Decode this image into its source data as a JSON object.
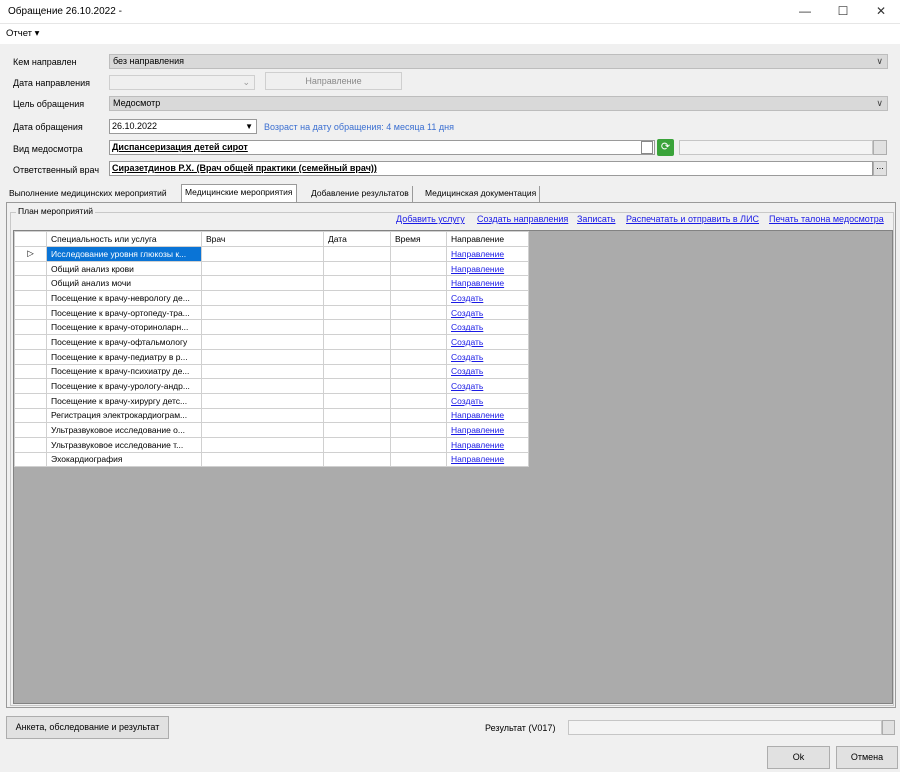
{
  "window": {
    "title": "Обращение 26.10.2022 -",
    "minimize": "—",
    "maximize": "☐",
    "close": "✕"
  },
  "menu": {
    "report": "Отчет ▾"
  },
  "form": {
    "referred_by": {
      "label": "Кем направлен",
      "value": "без направления"
    },
    "referral_date": {
      "label": "Дата направления",
      "value": "",
      "button": "Направление"
    },
    "purpose": {
      "label": "Цель обращения",
      "value": "Медосмотр"
    },
    "visit_date": {
      "label": "Дата обращения",
      "value": "26.10.2022",
      "age_note": "Возраст на дату обращения: 4 месяца 11 дня"
    },
    "exam_type": {
      "label": "Вид медосмотра",
      "value": "Диспансеризация детей сирот"
    },
    "doctor": {
      "label": "Ответственный врач",
      "value": "Сиразетдинов Р.Х. (Врач общей практики (семейный врач))"
    }
  },
  "tabs": [
    {
      "label": "Выполнение медицинских мероприятий"
    },
    {
      "label": "Медицинские мероприятия"
    },
    {
      "label": "Добавление результатов"
    },
    {
      "label": "Медицинская документация"
    }
  ],
  "plan": {
    "group_title": "План мероприятий",
    "actions": [
      "Добавить услугу",
      "Создать направления",
      "Записать",
      "Распечатать и отправить в ЛИС",
      "Печать талона медосмотра"
    ],
    "columns": [
      "Специальность или услуга",
      "Врач",
      "Дата",
      "Время",
      "Направление"
    ],
    "rows": [
      {
        "service": "Исследование уровня глюкозы к...",
        "doctor": "",
        "date": "",
        "time": "",
        "link": "Направление"
      },
      {
        "service": "Общий анализ крови",
        "doctor": "",
        "date": "",
        "time": "",
        "link": "Направление"
      },
      {
        "service": "Общий анализ мочи",
        "doctor": "",
        "date": "",
        "time": "",
        "link": "Направление"
      },
      {
        "service": "Посещение к врачу-неврологу де...",
        "doctor": "",
        "date": "",
        "time": "",
        "link": "Создать"
      },
      {
        "service": "Посещение к врачу-ортопеду-тра...",
        "doctor": "",
        "date": "",
        "time": "",
        "link": "Создать"
      },
      {
        "service": "Посещение к врачу-оториноларн...",
        "doctor": "",
        "date": "",
        "time": "",
        "link": "Создать"
      },
      {
        "service": "Посещение к врачу-офтальмологу",
        "doctor": "",
        "date": "",
        "time": "",
        "link": "Создать"
      },
      {
        "service": "Посещение к врачу-педиатру в р...",
        "doctor": "",
        "date": "",
        "time": "",
        "link": "Создать"
      },
      {
        "service": "Посещение к врачу-психиатру де...",
        "doctor": "",
        "date": "",
        "time": "",
        "link": "Создать"
      },
      {
        "service": "Посещение к врачу-урологу-андр...",
        "doctor": "",
        "date": "",
        "time": "",
        "link": "Создать"
      },
      {
        "service": "Посещение к врачу-хирургу детс...",
        "doctor": "",
        "date": "",
        "time": "",
        "link": "Создать"
      },
      {
        "service": "Регистрация электрокардиограм...",
        "doctor": "",
        "date": "",
        "time": "",
        "link": "Направление"
      },
      {
        "service": "Ультразвуковое исследование о...",
        "doctor": "",
        "date": "",
        "time": "",
        "link": "Направление"
      },
      {
        "service": "Ультразвуковое исследование т...",
        "doctor": "",
        "date": "",
        "time": "",
        "link": "Направление"
      },
      {
        "service": "Эхокардиография",
        "doctor": "",
        "date": "",
        "time": "",
        "link": "Направление"
      }
    ]
  },
  "footer": {
    "survey_button": "Анкета, обследование и результат",
    "result_label": "Результат (V017)",
    "ok": "Ok",
    "cancel": "Отмена"
  }
}
